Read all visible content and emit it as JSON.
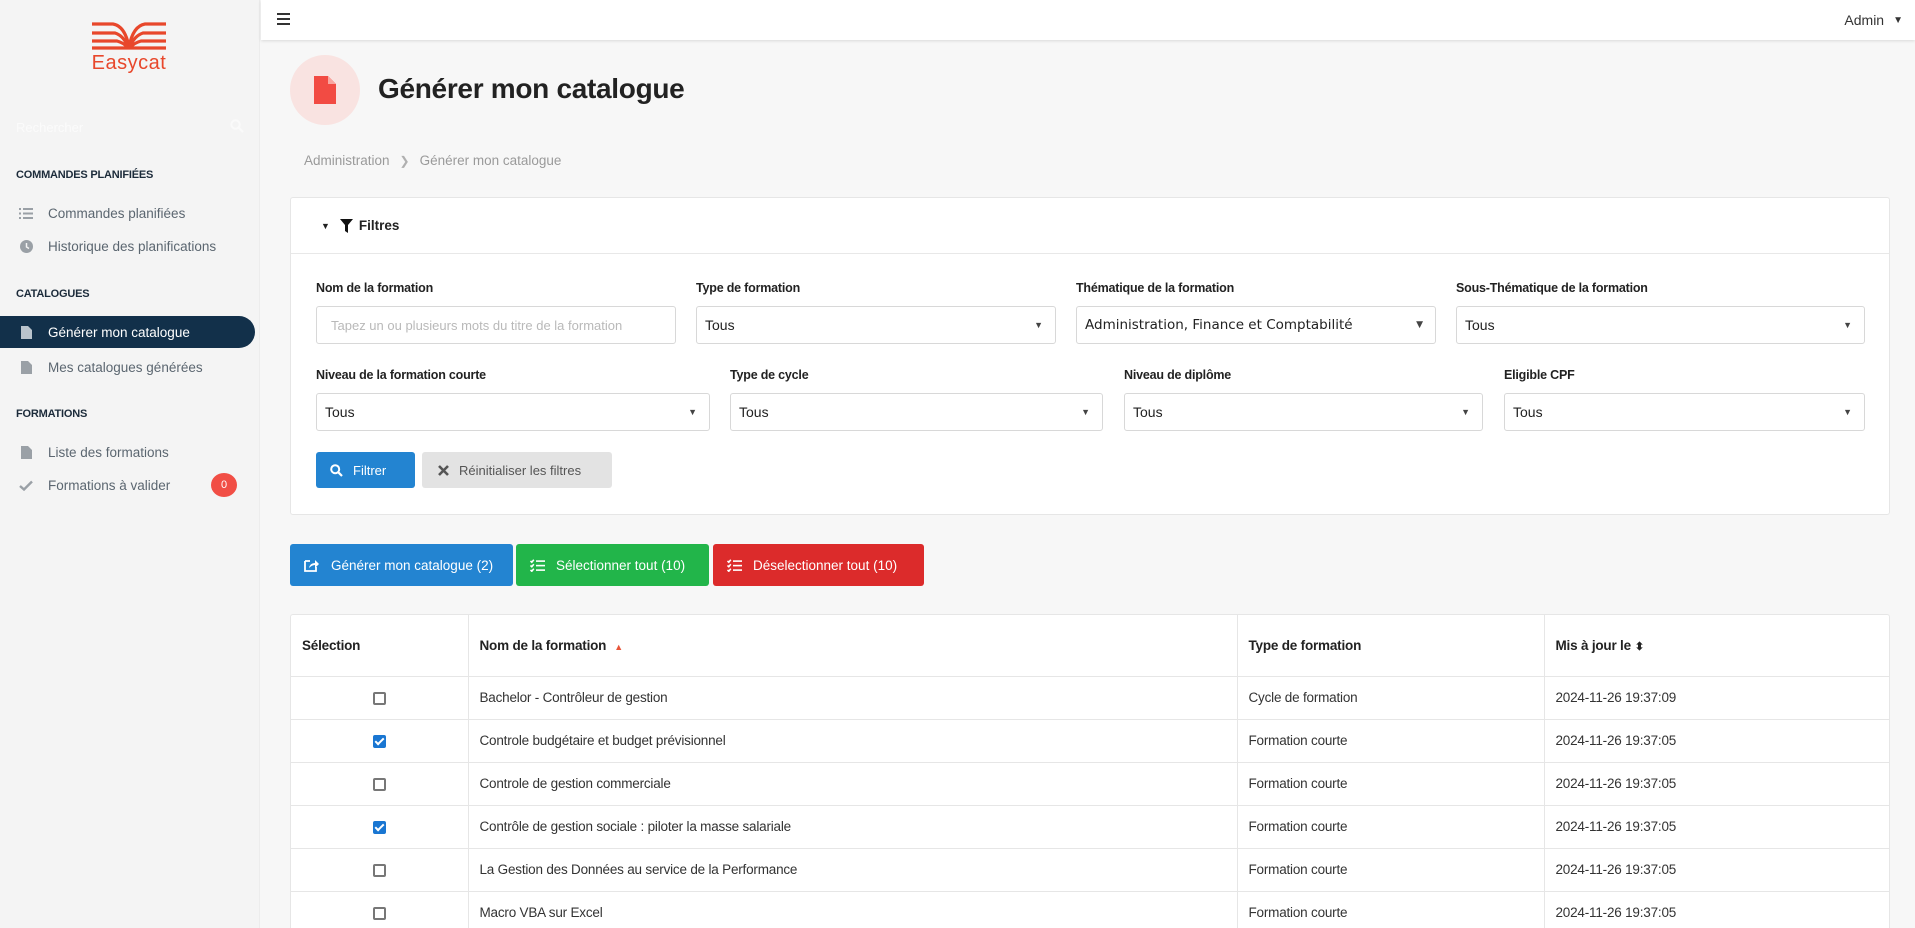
{
  "app": {
    "brand": "Easycat",
    "brand_color": "#e8472b"
  },
  "sidebar": {
    "search_placeholder": "Rechercher",
    "sections": [
      {
        "title": "COMMANDES PLANIFIÉES",
        "items": [
          {
            "label": "Commandes planifiées",
            "icon": "list-icon"
          },
          {
            "label": "Historique des planifications",
            "icon": "clock-icon"
          }
        ]
      },
      {
        "title": "CATALOGUES",
        "items": [
          {
            "label": "Générer mon catalogue",
            "icon": "file-icon",
            "active": true
          },
          {
            "label": "Mes catalogues générées",
            "icon": "file-icon"
          }
        ]
      },
      {
        "title": "FORMATIONS",
        "items": [
          {
            "label": "Liste des formations",
            "icon": "file-icon"
          },
          {
            "label": "Formations à valider",
            "icon": "check-icon",
            "badge": "0"
          }
        ]
      }
    ]
  },
  "topbar": {
    "user": "Admin"
  },
  "page": {
    "title": "Générer mon catalogue",
    "breadcrumb": [
      "Administration",
      "Générer mon catalogue"
    ]
  },
  "filters": {
    "title": "Filtres",
    "fields": {
      "nom": {
        "label": "Nom de la formation",
        "value": "",
        "placeholder": "Tapez un ou plusieurs mots du titre de la formation"
      },
      "type": {
        "label": "Type de formation",
        "value": "Tous"
      },
      "thematique": {
        "label": "Thématique de la formation",
        "value": "Administration, Finance et Comptabilité"
      },
      "sous_thematique": {
        "label": "Sous-Thématique de la formation",
        "value": "Tous"
      },
      "niveau_courte": {
        "label": "Niveau de la formation courte",
        "value": "Tous"
      },
      "type_cycle": {
        "label": "Type de cycle",
        "value": "Tous"
      },
      "niveau_diplome": {
        "label": "Niveau de diplôme",
        "value": "Tous"
      },
      "cpf": {
        "label": "Eligible CPF",
        "value": "Tous"
      }
    },
    "filter_button": "Filtrer",
    "reset_button": "Réinitialiser les filtres"
  },
  "actions": {
    "generate": "Générer mon catalogue (2)",
    "select_all": "Sélectionner tout (10)",
    "deselect_all": "Déselectionner tout (10)"
  },
  "table": {
    "columns": [
      "Sélection",
      "Nom de la formation",
      "Type de formation",
      "Mis à jour le"
    ],
    "rows": [
      {
        "selected": false,
        "name": "Bachelor - Contrôleur de gestion",
        "type": "Cycle de formation",
        "updated": "2024-11-26 19:37:09"
      },
      {
        "selected": true,
        "name": "Controle budgétaire et budget prévisionnel",
        "type": "Formation courte",
        "updated": "2024-11-26 19:37:05"
      },
      {
        "selected": false,
        "name": "Controle de gestion commerciale",
        "type": "Formation courte",
        "updated": "2024-11-26 19:37:05"
      },
      {
        "selected": true,
        "name": "Contrôle de gestion sociale : piloter la masse salariale",
        "type": "Formation courte",
        "updated": "2024-11-26 19:37:05"
      },
      {
        "selected": false,
        "name": "La Gestion des Données au service de la Performance",
        "type": "Formation courte",
        "updated": "2024-11-26 19:37:05"
      },
      {
        "selected": false,
        "name": "Macro VBA sur Excel",
        "type": "Formation courte",
        "updated": "2024-11-26 19:37:05"
      }
    ]
  }
}
